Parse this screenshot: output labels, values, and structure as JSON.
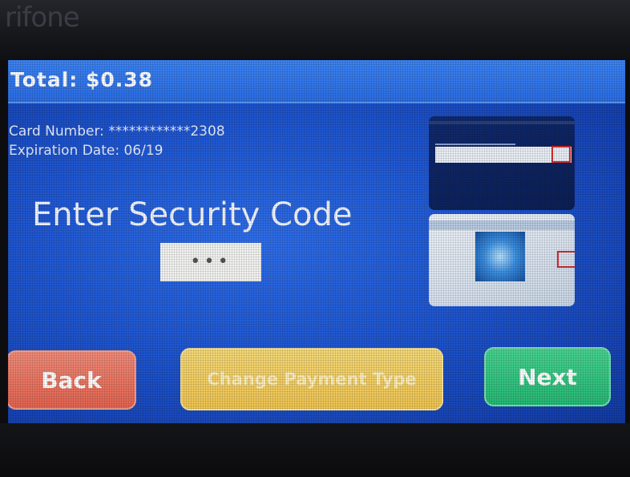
{
  "device": {
    "brand": "rifone"
  },
  "payment": {
    "total_label": "Total: $0.38",
    "card_number_label": "Card Number:",
    "card_number_value": "************2308",
    "expiration_label": "Expiration Date:",
    "expiration_value": "06/19",
    "heading": "Enter Security Code",
    "code_value": "•••"
  },
  "buttons": {
    "back": "Back",
    "change_payment": "Change Payment Type",
    "next": "Next"
  },
  "colors": {
    "screen_blue": "#1f56d0",
    "back": "#e2634f",
    "change": "#eec350",
    "next": "#25b874"
  }
}
